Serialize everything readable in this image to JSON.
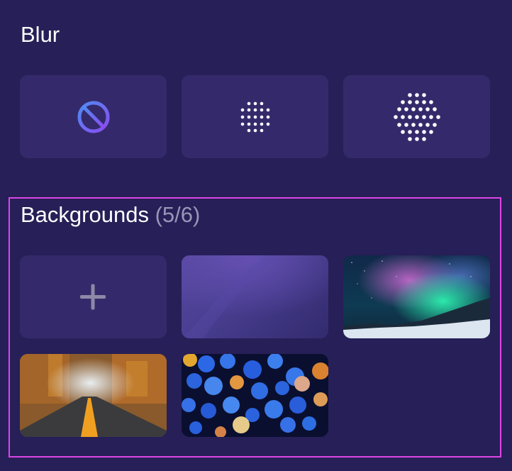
{
  "blur": {
    "title": "Blur",
    "options": [
      {
        "name": "none",
        "icon": "no-blur-icon"
      },
      {
        "name": "light",
        "icon": "light-blur-dots-icon"
      },
      {
        "name": "strong",
        "icon": "strong-blur-dots-icon"
      }
    ]
  },
  "backgrounds": {
    "title": "Backgrounds",
    "count": "(5/6)",
    "add_icon": "plus-icon",
    "items": [
      {
        "name": "purple-gradient"
      },
      {
        "name": "northern-lights"
      },
      {
        "name": "autumn-road"
      },
      {
        "name": "bokeh-lights"
      }
    ]
  },
  "colors": {
    "background": "#271f57",
    "tile": "#342a6b",
    "selection_border": "#dd45e6",
    "no_blur_icon_start": "#4f8bf3",
    "no_blur_icon_end": "#8a4cf0",
    "count_text": "#9a95b8"
  }
}
